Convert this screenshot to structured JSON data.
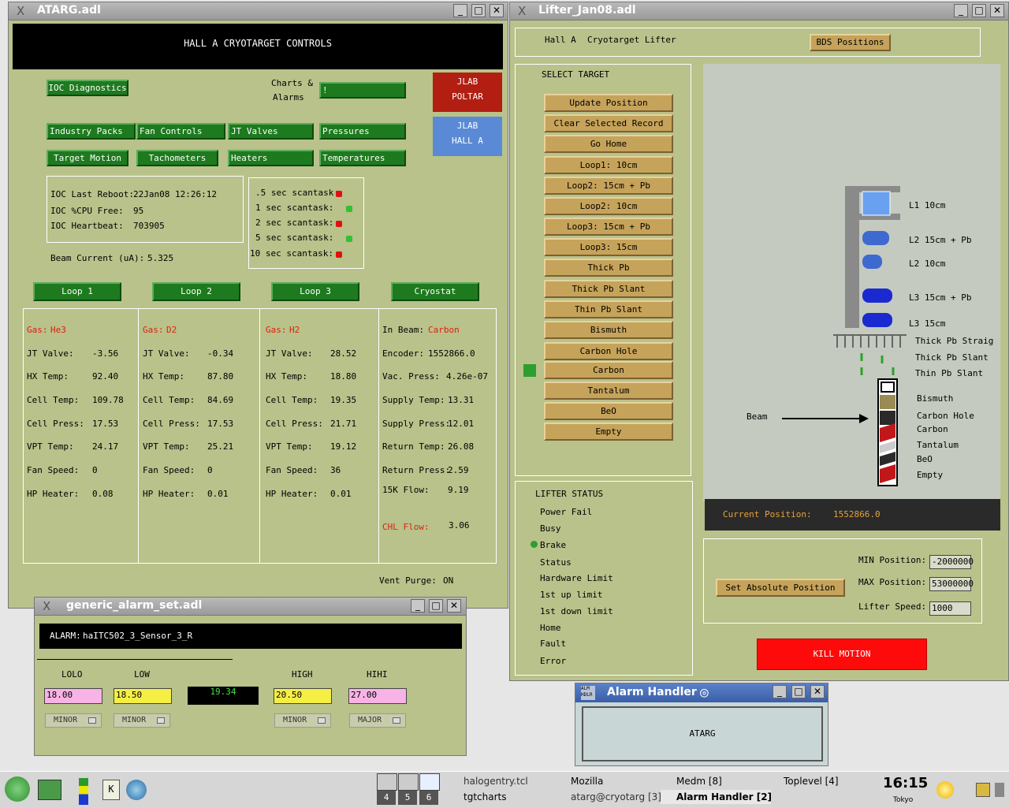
{
  "atarg": {
    "title": "ATARG.adl",
    "banner": "HALL A CRYOTARGET CONTROLS",
    "ioc_diag": "IOC Diagnostics",
    "charts_line1": "Charts &",
    "charts_line2": "Alarms",
    "charts_btn": "!",
    "jlab_poltar_1": "JLAB",
    "jlab_poltar_2": "POLTAR",
    "jlab_halla_1": "JLAB",
    "jlab_halla_2": "HALL A",
    "buttons": [
      "Industry Packs",
      "Fan Controls",
      "JT Valves",
      "Pressures",
      "Target Motion",
      "Tachometers",
      "Heaters",
      "Temperatures"
    ],
    "ioc": {
      "reboot_label": "IOC Last Reboot:",
      "reboot_value": "22Jan08 12:26:12",
      "cpu_label": "IOC %CPU Free:",
      "cpu_value": "95",
      "hb_label": "IOC Heartbeat:",
      "hb_value": "703905"
    },
    "scantasks": [
      ".5 sec scantask:",
      "1 sec scantask:",
      "2 sec scantask:",
      "5 sec scantask:",
      "10 sec scantask:"
    ],
    "scan_colors": [
      "#e01010",
      "#30c030",
      "#e01010",
      "#30c030",
      "#e01010"
    ],
    "beam_label": "Beam Current (uA):",
    "beam_value": "5.325",
    "loops": [
      "Loop 1",
      "Loop 2",
      "Loop 3",
      "Cryostat"
    ],
    "loop_labels": [
      "JT Valve:",
      "HX Temp:",
      "Cell Temp:",
      "Cell Press:",
      "VPT Temp:",
      "Fan Speed:",
      "HP Heater:"
    ],
    "loop1": {
      "gas_label": "Gas:",
      "gas": "He3",
      "vals": [
        "-3.56",
        "92.40",
        "109.78",
        "17.53",
        "24.17",
        "0",
        "0.08"
      ]
    },
    "loop2": {
      "gas_label": "Gas:",
      "gas": "D2",
      "vals": [
        "-0.34",
        "87.80",
        "84.69",
        "17.53",
        "25.21",
        "0",
        "0.01"
      ]
    },
    "loop3": {
      "gas_label": "Gas:",
      "gas": "H2",
      "vals": [
        "28.52",
        "18.80",
        "19.35",
        "21.71",
        "19.12",
        "36",
        "0.01"
      ]
    },
    "cryo": {
      "inbeam_label": "In Beam:",
      "inbeam": "Carbon",
      "labels": [
        "Encoder:",
        "Vac. Press:",
        "Supply Temp:",
        "Supply Press:",
        "Return Temp:",
        "Return Press:",
        "15K Flow:"
      ],
      "vals": [
        "1552866.0",
        "4.26e-07",
        "13.31",
        "12.01",
        "26.08",
        "2.59",
        "9.19"
      ],
      "chl_label": "CHL Flow:",
      "chl": "3.06"
    },
    "vent_label": "Vent Purge:",
    "vent": "ON"
  },
  "lifter": {
    "title": "Lifter_Jan08.adl",
    "hall": "Hall A",
    "cryo": "Cryotarget Lifter",
    "bds": "BDS Positions",
    "select": "SELECT TARGET",
    "targets": [
      "Update Position",
      "Clear Selected Record",
      "Go Home",
      "Loop1: 10cm",
      "Loop2: 15cm + Pb",
      "Loop2: 10cm",
      "Loop3: 15cm + Pb",
      "Loop3: 15cm",
      "Thick Pb",
      "Thick Pb Slant",
      "Thin Pb Slant",
      "Bismuth",
      "Carbon Hole",
      "Carbon",
      "Tantalum",
      "BeO",
      "Empty"
    ],
    "status_title": "LIFTER STATUS",
    "status": [
      "Power Fail",
      "Busy",
      "Brake",
      "Status",
      "Hardware Limit",
      "1st up limit",
      "1st down limit",
      "Home",
      "Fault",
      "Error"
    ],
    "diagram_labels": [
      "L1 10cm",
      "L2 15cm + Pb",
      "L2 10cm",
      "L3 15cm + Pb",
      "L3 15cm",
      "Thick Pb Straig",
      "Thick Pb Slant",
      "Thin Pb Slant",
      "Bismuth",
      "Carbon Hole",
      "Carbon",
      "Tantalum",
      "BeO",
      "Empty"
    ],
    "beam": "Beam",
    "cur_label": "Current Position:",
    "cur": "1552866.0",
    "set_abs": "Set Absolute Position",
    "min_label": "MIN Position:",
    "min": "-2000000",
    "max_label": "MAX Position:",
    "max": "53000000",
    "speed_label": "Lifter Speed:",
    "speed": "1000",
    "kill": "KILL MOTION"
  },
  "alarmset": {
    "title": "generic_alarm_set.adl",
    "alarm_label": "ALARM:",
    "alarm": "haITC502_3_Sensor_3_R",
    "lolo": "LOLO",
    "low": "LOW",
    "high": "HIGH",
    "hihi": "HIHI",
    "lolo_v": "18.00",
    "low_v": "18.50",
    "cur": "19.34",
    "high_v": "20.50",
    "hihi_v": "27.00",
    "sev": [
      "MINOR",
      "MINOR",
      "MINOR",
      "MAJOR"
    ]
  },
  "alarmhandler": {
    "title": "Alarm Handler",
    "atarg": "ATARG"
  },
  "taskbar": {
    "pager": [
      "4",
      "5",
      "6"
    ],
    "tasks_top": [
      "halogentry.tcl",
      "Mozilla",
      "Medm [8]",
      "Toplevel [4]"
    ],
    "tasks_bot": [
      "tgtcharts",
      "atarg@cryotarg [3]",
      "Alarm Handler [2]"
    ],
    "time": "16:15",
    "city": "Tokyo"
  }
}
